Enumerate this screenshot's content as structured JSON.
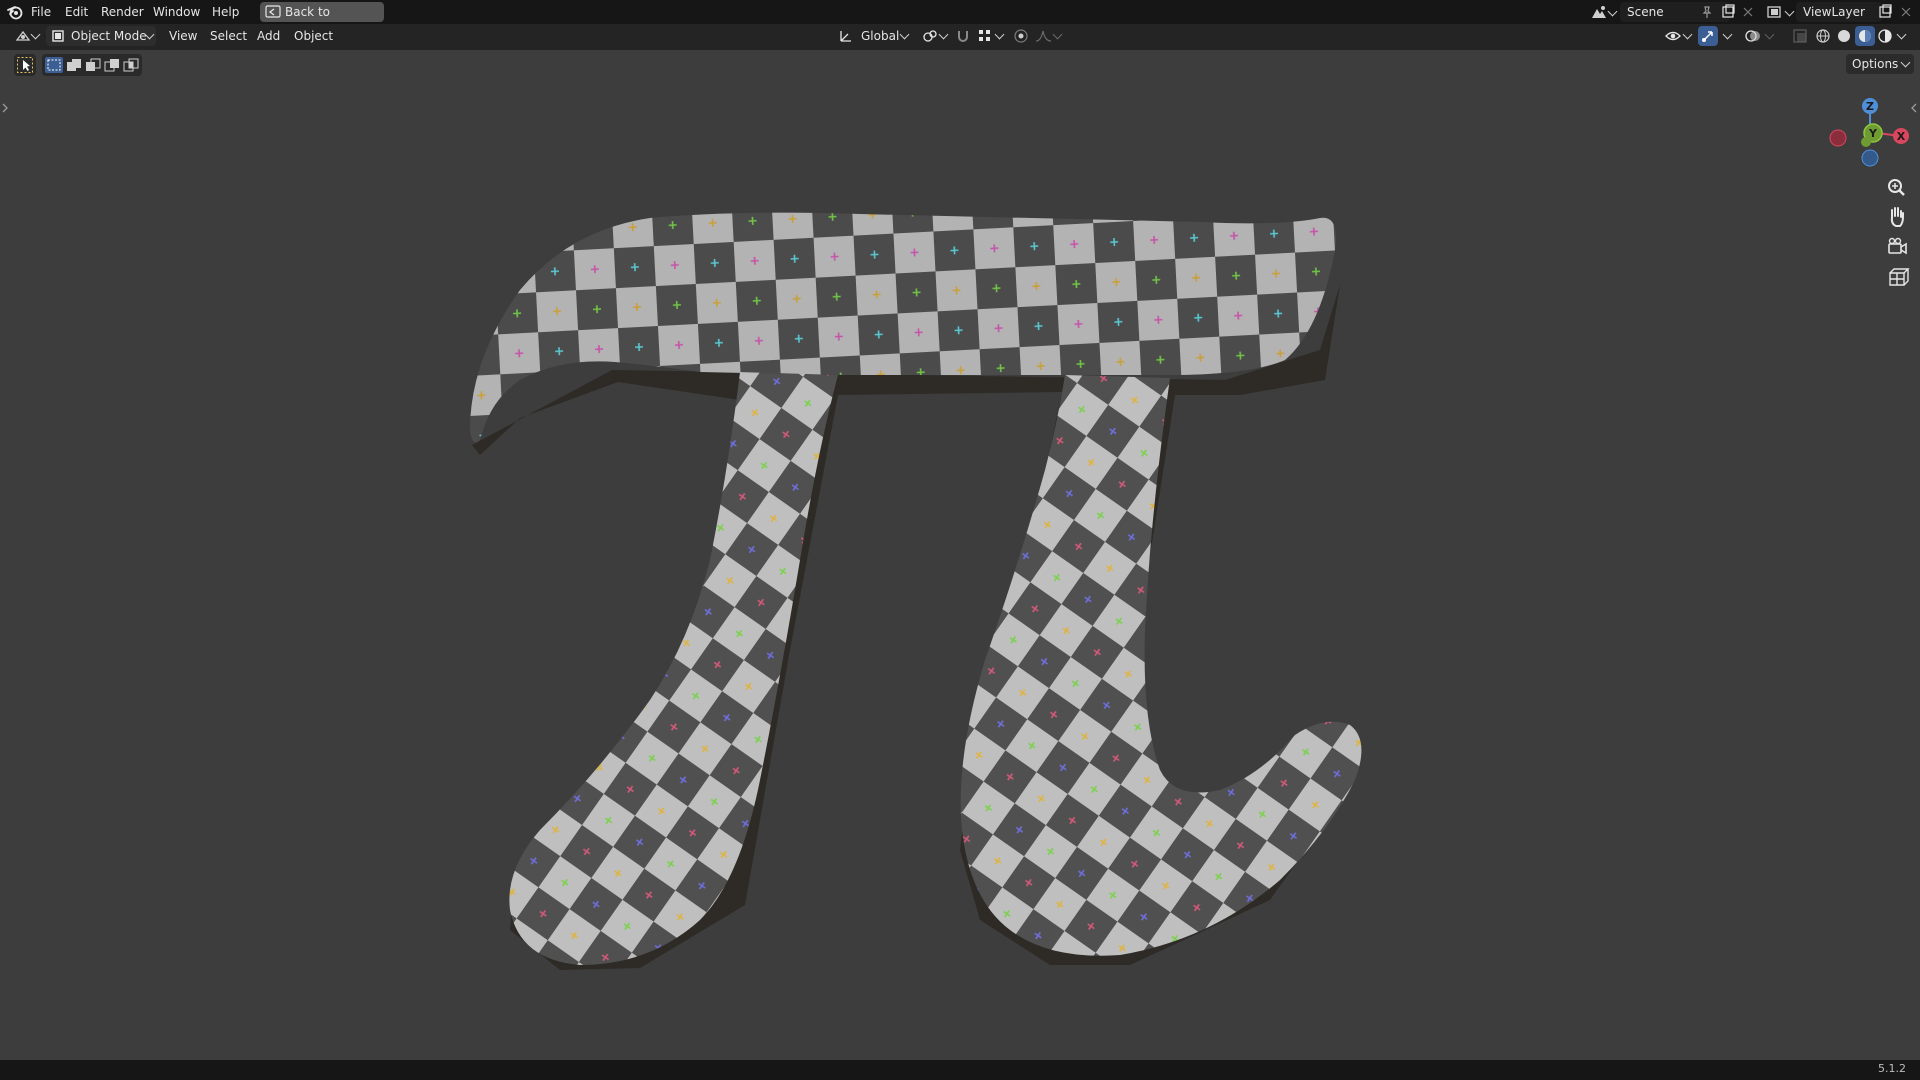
{
  "menubar": {
    "items": [
      "File",
      "Edit",
      "Render",
      "Window",
      "Help"
    ],
    "back_button": "Back to Previous",
    "scene": "Scene",
    "view_layer": "ViewLayer"
  },
  "header": {
    "mode": "Object Mode",
    "menus": [
      "View",
      "Select",
      "Add",
      "Object"
    ],
    "transform_orientation": "Global",
    "options": "Options"
  },
  "gizmo": {
    "x": "X",
    "y": "Y",
    "z": "Z"
  },
  "icons": {
    "nav": [
      "zoom-icon",
      "hand-pan-icon",
      "camera-view-icon",
      "ortho-grid-icon"
    ]
  },
  "statusbar": {
    "version": "5.1.2"
  }
}
